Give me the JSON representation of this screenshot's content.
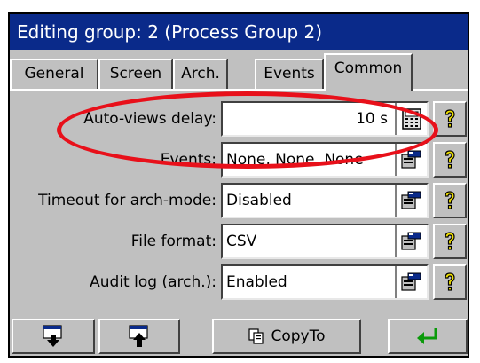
{
  "window": {
    "title": "Editing group: 2 (Process Group 2)"
  },
  "tabs": [
    {
      "label": "General",
      "active": false
    },
    {
      "label": "Screen",
      "active": false
    },
    {
      "label": "Arch.",
      "active": false
    },
    {
      "label": "Events",
      "active": false
    },
    {
      "label": "Common",
      "active": true
    }
  ],
  "fields": [
    {
      "label": "Auto-views delay:",
      "value": "10 s",
      "button_icon": "calculator-icon",
      "highlighted": true
    },
    {
      "label": "Events:",
      "value": "None, None, None",
      "button_icon": "edit-dialog-icon"
    },
    {
      "label": "Timeout for arch-mode:",
      "value": "Disabled",
      "button_icon": "edit-dialog-icon"
    },
    {
      "label": "File format:",
      "value": "CSV",
      "button_icon": "edit-dialog-icon"
    },
    {
      "label": "Audit log (arch.):",
      "value": "Enabled",
      "button_icon": "edit-dialog-icon"
    }
  ],
  "help_icon": "question-mark-icon",
  "toolbar": {
    "copy_label": "CopyTo",
    "buttons": [
      "export-down-icon",
      "import-up-icon",
      "copy-icon",
      "enter-icon"
    ]
  },
  "colors": {
    "title_bar": "#0a2a8a",
    "highlight": "#e8101a",
    "help_yellow": "#f0e000",
    "enter_green": "#0a9a0a"
  }
}
